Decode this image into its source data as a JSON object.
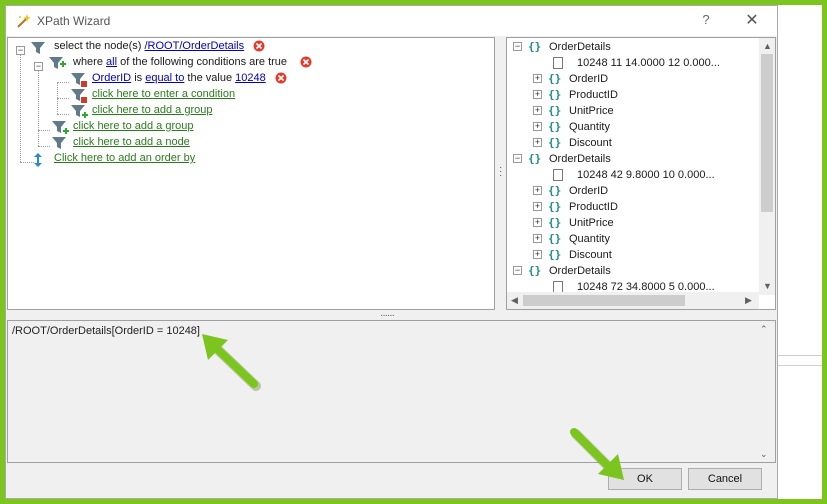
{
  "window": {
    "title": "XPath Wizard",
    "help": "?",
    "close": "✕"
  },
  "left_tree": {
    "select_prefix": "select the node(s)",
    "select_path": "/ROOT/OrderDetails",
    "where_prefix": "where",
    "where_all": "all",
    "where_suffix": "of the following conditions are true",
    "cond_field": "OrderID",
    "cond_is": "is",
    "cond_op": "equal to",
    "cond_the_value": "the value",
    "cond_value": "10248",
    "enter_condition": "click here to enter a condition",
    "add_group_inner": "click here to add a group",
    "add_group_outer": "click here to add a group",
    "add_node": "click here to add a node",
    "add_order": "Click here to add an order by"
  },
  "right_tree": {
    "nodes": [
      {
        "type": "element",
        "label": "OrderDetails",
        "indent": 0
      },
      {
        "type": "text",
        "label": "10248  11  14.0000  12  0.000...",
        "indent": 1
      },
      {
        "type": "element",
        "label": "OrderID",
        "indent": 1
      },
      {
        "type": "element",
        "label": "ProductID",
        "indent": 1
      },
      {
        "type": "element",
        "label": "UnitPrice",
        "indent": 1
      },
      {
        "type": "element",
        "label": "Quantity",
        "indent": 1
      },
      {
        "type": "element",
        "label": "Discount",
        "indent": 1
      },
      {
        "type": "element",
        "label": "OrderDetails",
        "indent": 0
      },
      {
        "type": "text",
        "label": "10248  42  9.8000  10  0.000...",
        "indent": 1
      },
      {
        "type": "element",
        "label": "OrderID",
        "indent": 1
      },
      {
        "type": "element",
        "label": "ProductID",
        "indent": 1
      },
      {
        "type": "element",
        "label": "UnitPrice",
        "indent": 1
      },
      {
        "type": "element",
        "label": "Quantity",
        "indent": 1
      },
      {
        "type": "element",
        "label": "Discount",
        "indent": 1
      },
      {
        "type": "element",
        "label": "OrderDetails",
        "indent": 0
      },
      {
        "type": "text",
        "label": "10248  72  34.8000  5  0.000...",
        "indent": 1
      }
    ]
  },
  "xpath": {
    "expression": "/ROOT/OrderDetails[OrderID = 10248]"
  },
  "buttons": {
    "ok": "OK",
    "cancel": "Cancel"
  },
  "colors": {
    "annotation_arrow": "#7cc51f",
    "link": "#0000cc",
    "green_link": "#2a7d1c",
    "element_icon": "#1f8a8a"
  }
}
